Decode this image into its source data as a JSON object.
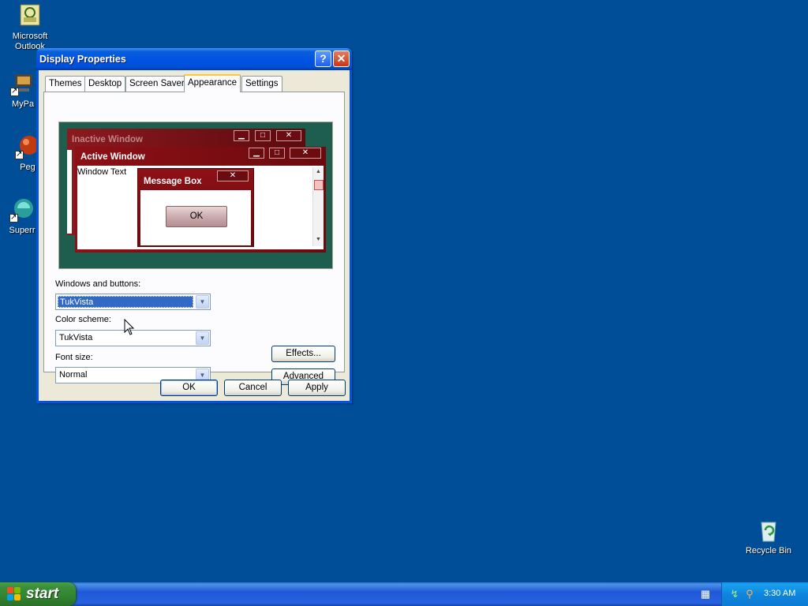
{
  "desktop": {
    "icons": [
      {
        "label": "Microsoft Outlook",
        "icon": "outlook-icon"
      },
      {
        "label": "MyPa",
        "icon": "mypc-icon"
      },
      {
        "label": "Peg",
        "icon": "peg-icon"
      },
      {
        "label": "Superr",
        "icon": "super-icon"
      }
    ],
    "recycle_bin": "Recycle Bin"
  },
  "dialog": {
    "title": "Display Properties",
    "help_glyph": "?",
    "close_glyph": "✕",
    "tabs": [
      {
        "label": "Themes"
      },
      {
        "label": "Desktop"
      },
      {
        "label": "Screen Saver"
      },
      {
        "label": "Appearance",
        "active": true
      },
      {
        "label": "Settings"
      }
    ],
    "preview": {
      "inactive_title": "Inactive Window",
      "active_title": "Active Window",
      "window_text": "Window Text",
      "message_box_title": "Message Box",
      "ok_label": "OK",
      "min_glyph": "▁",
      "max_glyph": "□",
      "close_glyph": "✕"
    },
    "windows_buttons": {
      "label": "Windows and buttons:",
      "value": "TukVista"
    },
    "color_scheme": {
      "label": "Color scheme:",
      "value": "TukVista"
    },
    "font_size": {
      "label": "Font size:",
      "value": "Normal"
    },
    "effects_label": "Effects...",
    "advanced_label": "Advanced",
    "ok_label": "OK",
    "cancel_label": "Cancel",
    "apply_label": "Apply"
  },
  "taskbar": {
    "start_label": "start",
    "clock": "3:30 AM"
  },
  "colors": {
    "desktop": "#004e98",
    "titlebar": "#0054e3",
    "preview_bg": "#1d5e4e",
    "theme_red": "#7d0d12"
  }
}
